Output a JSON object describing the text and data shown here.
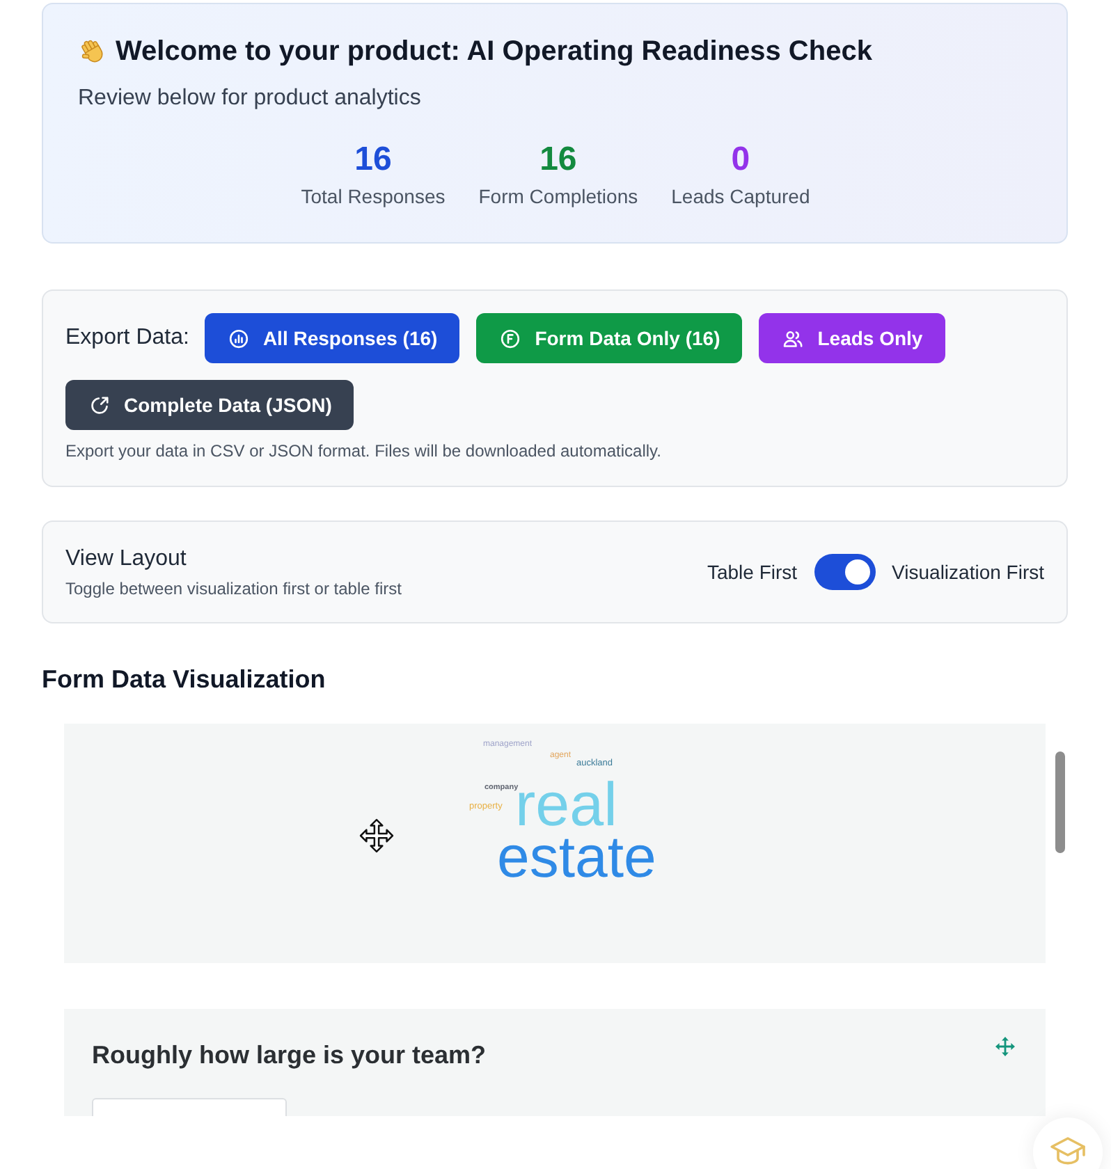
{
  "header": {
    "title": "Welcome to your product: AI Operating Readiness Check",
    "subtitle": "Review below for product analytics",
    "stats": [
      {
        "value": "16",
        "label": "Total Responses",
        "color": "#1d4ed8"
      },
      {
        "value": "16",
        "label": "Form Completions",
        "color": "#138a3f"
      },
      {
        "value": "0",
        "label": "Leads Captured",
        "color": "#9333ea"
      }
    ]
  },
  "export": {
    "label": "Export Data:",
    "buttons": [
      {
        "label": "All Responses (16)",
        "kind": "responses",
        "color": "#1d4ed8"
      },
      {
        "label": "Form Data Only (16)",
        "kind": "form",
        "color": "#0f9a47"
      },
      {
        "label": "Leads Only",
        "kind": "leads",
        "color": "#9333ea"
      },
      {
        "label": "Complete Data (JSON)",
        "kind": "json",
        "color": "#374151"
      }
    ],
    "note": "Export your data in CSV or JSON format. Files will be downloaded automatically."
  },
  "view_layout": {
    "title": "View Layout",
    "subtitle": "Toggle between visualization first or table first",
    "off_label": "Table First",
    "on_label": "Visualization First",
    "on": true
  },
  "visualization": {
    "title": "Form Data Visualization",
    "words": [
      {
        "text": "management",
        "color": "#9ea3c9"
      },
      {
        "text": "agent",
        "color": "#e2a55c"
      },
      {
        "text": "auckland",
        "color": "#3d7c99"
      },
      {
        "text": "company",
        "color": "#5f6470"
      },
      {
        "text": "property",
        "color": "#e8b043"
      },
      {
        "text": "real",
        "color": "#74d0ea"
      },
      {
        "text": "estate",
        "color": "#2f8ae6"
      }
    ]
  },
  "question_card": {
    "title": "Roughly how large is your team?"
  }
}
